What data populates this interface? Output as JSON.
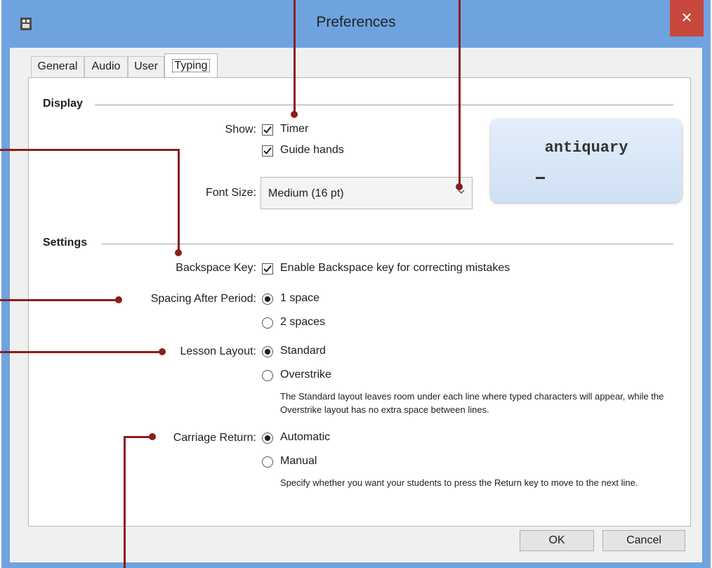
{
  "window": {
    "title": "Preferences",
    "close_glyph": "✕",
    "app_icon": "app-icon"
  },
  "tabs": [
    {
      "label": "General",
      "active": false
    },
    {
      "label": "Audio",
      "active": false
    },
    {
      "label": "User",
      "active": false
    },
    {
      "label": "Typing",
      "active": true
    }
  ],
  "display": {
    "section_title": "Display",
    "show_label": "Show:",
    "timer": {
      "label": "Timer",
      "checked": true
    },
    "guide_hands": {
      "label": "Guide hands",
      "checked": true
    },
    "font_size_label": "Font Size:",
    "font_size_value": "Medium (16 pt)",
    "preview_word": "antiquary"
  },
  "settings": {
    "section_title": "Settings",
    "backspace_label": "Backspace Key:",
    "backspace_option": {
      "label": "Enable Backspace key for correcting mistakes",
      "checked": true
    },
    "spacing_label": "Spacing After Period:",
    "spacing_options": [
      {
        "label": "1 space",
        "selected": true
      },
      {
        "label": "2 spaces",
        "selected": false
      }
    ],
    "layout_label": "Lesson Layout:",
    "layout_options": [
      {
        "label": "Standard",
        "selected": true
      },
      {
        "label": "Overstrike",
        "selected": false
      }
    ],
    "layout_help": "The Standard layout leaves room under each line where typed characters will appear, while the Overstrike layout has no extra space between lines.",
    "carriage_label": "Carriage Return:",
    "carriage_options": [
      {
        "label": "Automatic",
        "selected": true
      },
      {
        "label": "Manual",
        "selected": false
      }
    ],
    "carriage_help": "Specify whether you want your students to press the Return key to move to the next line."
  },
  "buttons": {
    "ok": "OK",
    "cancel": "Cancel"
  },
  "colors": {
    "titlebar": "#6fa3df",
    "close": "#c7483d",
    "callout": "#8c1d1d"
  }
}
